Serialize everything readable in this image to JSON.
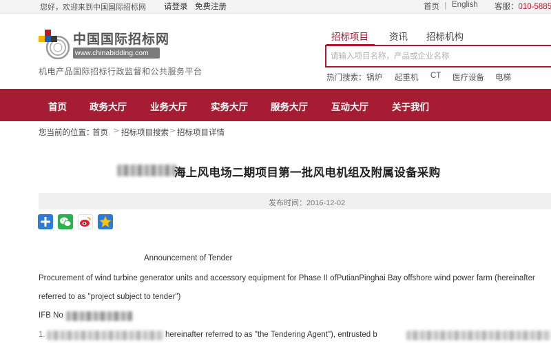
{
  "topbar": {
    "welcome": "您好，欢迎来到中国国际招标网",
    "login": "请登录",
    "register": "免费注册",
    "home": "首页",
    "separator": "|",
    "english": "English",
    "hotline_label": "客服：",
    "hotline_number": "010-5885"
  },
  "header": {
    "logo_name": "中国国际招标网",
    "logo_url": "www.chinabidding.com",
    "slogan": "机电产品国际招标行政监督和公共服务平台"
  },
  "search": {
    "tabs": [
      {
        "label": "招标项目",
        "active": true
      },
      {
        "label": "资讯",
        "active": false
      },
      {
        "label": "招标机构",
        "active": false
      }
    ],
    "placeholder": "请输入项目名称，产品或企业名称",
    "hot_label": "热门搜索：",
    "hot_terms": [
      "锅炉",
      "起重机",
      "CT",
      "医疗设备",
      "电梯"
    ]
  },
  "nav": {
    "items": [
      "首页",
      "政务大厅",
      "业务大厅",
      "实务大厅",
      "服务大厅",
      "互动大厅",
      "关于我们"
    ]
  },
  "breadcrumb": {
    "label": "您当前的位置：",
    "items": [
      "首页",
      "招标项目搜索",
      "招标项目详情"
    ],
    "separator": ">"
  },
  "article": {
    "title": "海上风电场二期项目第一批风电机组及附属设备采购",
    "pub_label": "发布时间：",
    "pub_date": "2016-12-02",
    "body": {
      "heading": "Announcement of Tender",
      "line1": "Procurement of wind turbine generator units and accessory equipment for Phase II ofPutianPinghai Bay offshore wind power farm (hereinafter",
      "line2": "referred to as \"project subject to tender\")",
      "ifb_label": "IFB No",
      "line4_a": "1.",
      "line4_b": "hereinafter referred to as \"the Tendering Agent\"), entrusted b"
    }
  },
  "colors": {
    "brand_red": "#a61c32",
    "accent_red": "#b3162c"
  },
  "share_icons": [
    "share-plus-icon",
    "wechat-icon",
    "weibo-icon",
    "favorite-star-icon"
  ]
}
